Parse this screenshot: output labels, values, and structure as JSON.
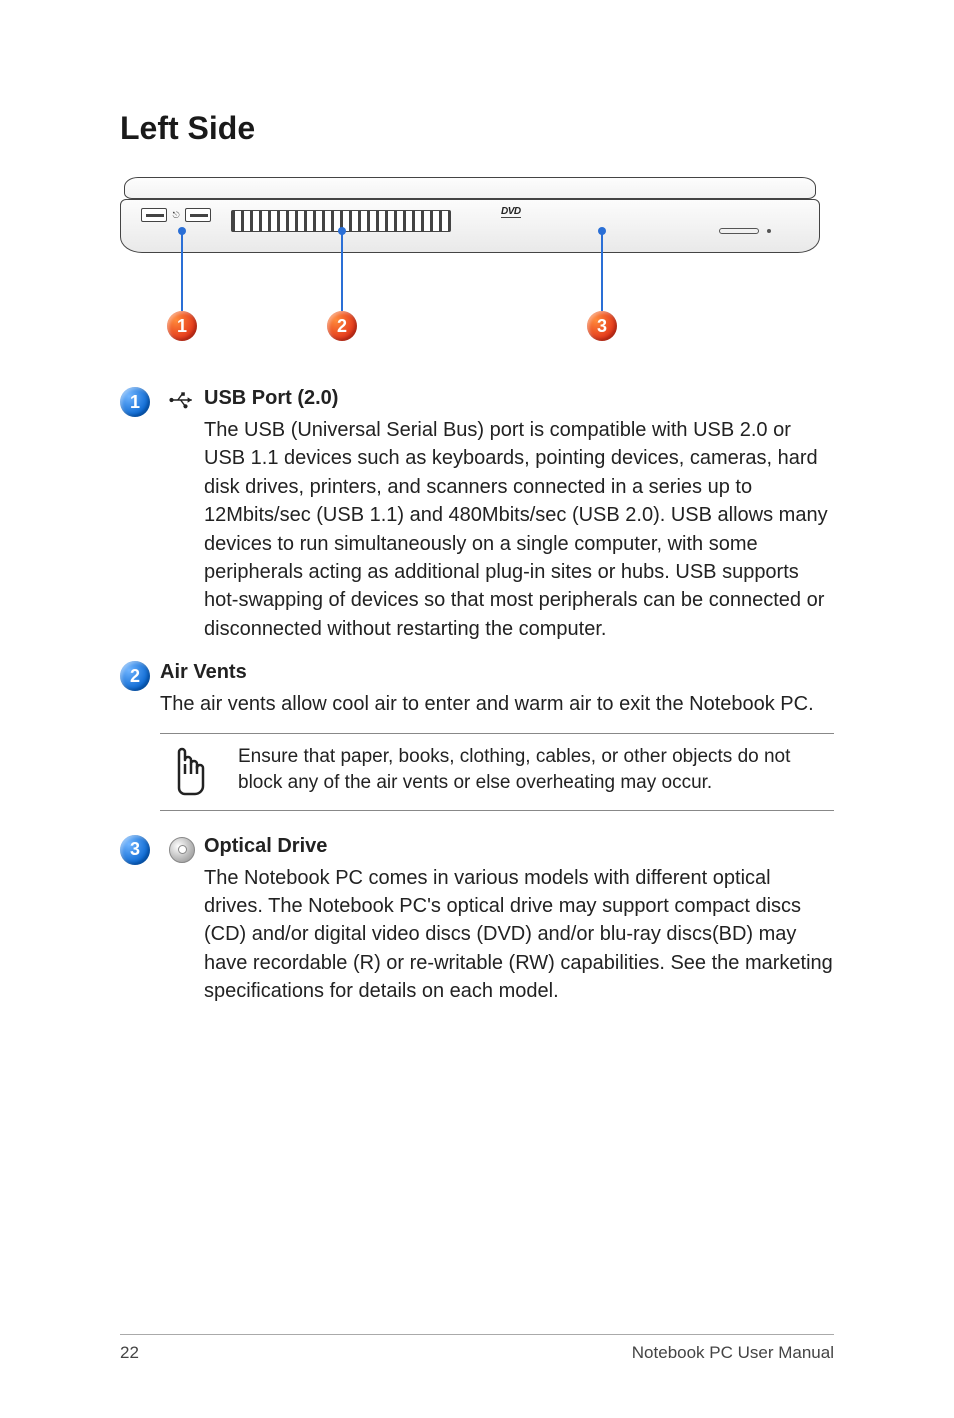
{
  "heading": "Left Side",
  "diagram": {
    "dvd_text": "DVD",
    "callouts": [
      {
        "num": "1"
      },
      {
        "num": "2"
      },
      {
        "num": "3"
      }
    ]
  },
  "items": [
    {
      "num": "1",
      "icon": "usb",
      "title": "USB Port (2.0)",
      "body": "The USB (Universal Serial Bus) port is compatible with USB 2.0 or USB 1.1 devices such as keyboards, pointing devices, cameras, hard disk drives, printers, and scanners connected in a series up to 12Mbits/sec (USB 1.1) and 480Mbits/sec (USB 2.0). USB allows many devices to run simultaneously on a single computer, with some peripherals acting as additional plug-in sites or hubs. USB supports hot-swapping of devices so that most peripherals can be connected or disconnected without restarting the computer."
    },
    {
      "num": "2",
      "icon": "",
      "title": "Air Vents",
      "body": "The air vents allow cool air to enter and warm air to exit the Notebook PC.",
      "note": "Ensure that paper, books, clothing, cables, or other objects do not block any of the air vents or else overheating may occur."
    },
    {
      "num": "3",
      "icon": "disc",
      "title": "Optical Drive",
      "body": "The Notebook PC comes in various models with different optical drives. The Notebook PC's optical drive may support compact discs (CD) and/or digital video discs (DVD) and/or blu-ray discs(BD) may have recordable (R) or re-writable (RW) capabilities. See the marketing specifications for details on each model."
    }
  ],
  "footer": {
    "page": "22",
    "title": "Notebook PC User Manual"
  }
}
